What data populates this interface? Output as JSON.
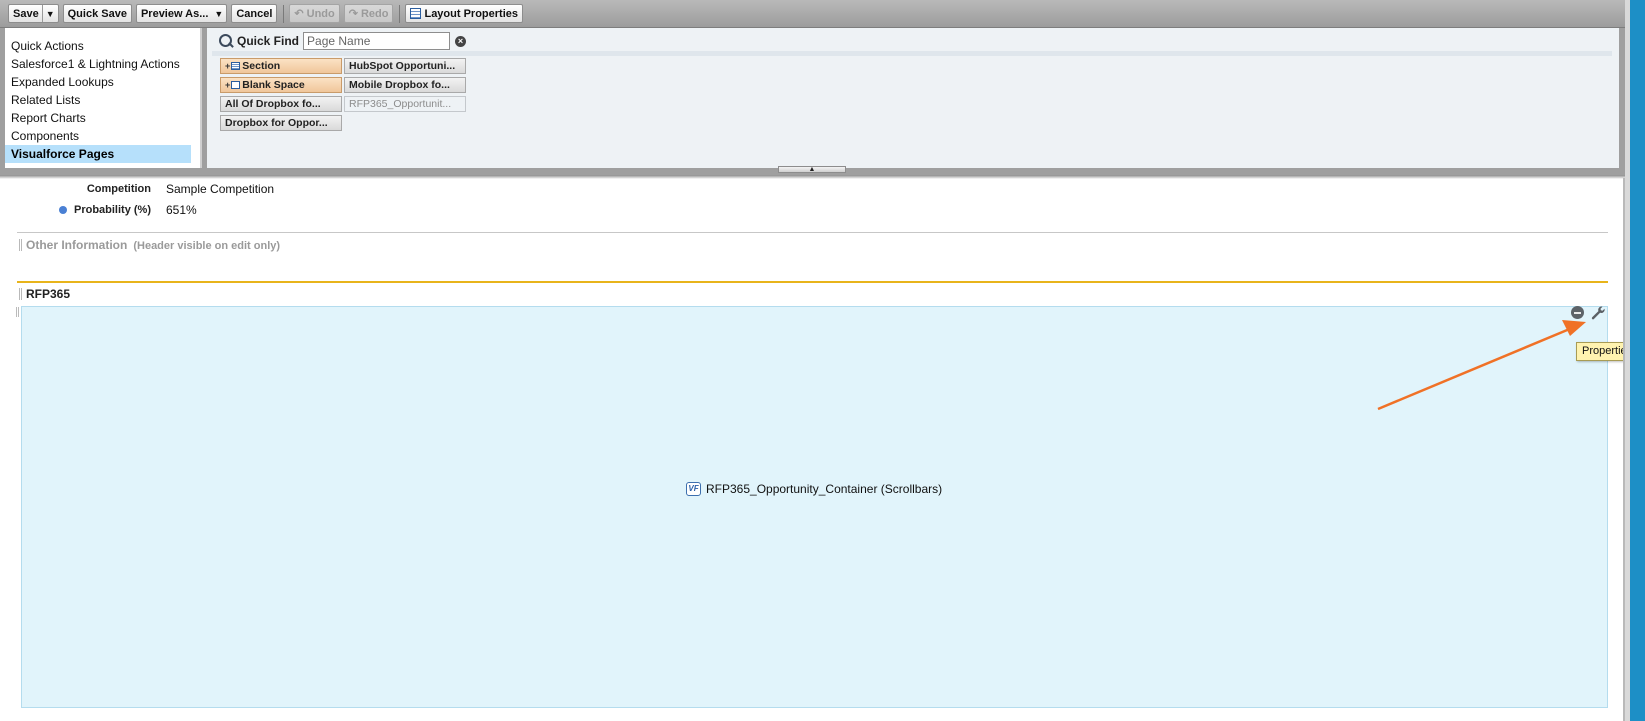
{
  "toolbar": {
    "save": "Save",
    "quick_save": "Quick Save",
    "preview_as": "Preview As...",
    "cancel": "Cancel",
    "undo": "Undo",
    "redo": "Redo",
    "layout_properties": "Layout Properties"
  },
  "palette": {
    "categories": [
      "Quick Actions",
      "Salesforce1 & Lightning Actions",
      "Expanded Lookups",
      "Related Lists",
      "Report Charts",
      "Components",
      "Visualforce Pages"
    ],
    "selected_category": "Visualforce Pages",
    "quick_find_label": "Quick Find",
    "quick_find_placeholder": "Page Name",
    "items": {
      "section": "Section",
      "blank_space": "Blank Space",
      "all_of_dropbox": "All Of Dropbox fo...",
      "dropbox_for_oppor": "Dropbox for Oppor...",
      "hubspot": "HubSpot Opportuni...",
      "mobile_dropbox": "Mobile Dropbox fo...",
      "rfp365_opportunit": "RFP365_Opportunit..."
    }
  },
  "layout": {
    "fields": [
      {
        "label": "Competition",
        "value": "Sample Competition",
        "required": false
      },
      {
        "label": "Probability (%)",
        "value": "651%",
        "required": true
      }
    ],
    "other_info_title": "Other Information",
    "other_info_note": "(Header visible on edit only)",
    "rfp_section_title": "RFP365",
    "vf_component_label": "RFP365_Opportunity_Container (Scrollbars)",
    "vf_icon_text": "VF",
    "tooltip": "Properties"
  },
  "colors": {
    "toolbar": "#a9a9a9",
    "palette_bg": "#9f9f9f",
    "selected_category": "#b6e0fb",
    "vf_block": "#e1f4fb",
    "section_accent": "#e8b41b",
    "annotation_arrow": "#f07126",
    "right_strip": "#1d8fc6"
  }
}
